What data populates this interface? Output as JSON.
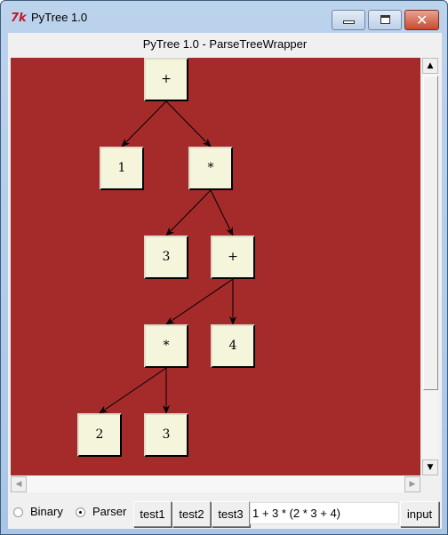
{
  "window": {
    "title": "PyTree 1.0",
    "app_icon": "tk-icon"
  },
  "subtitle": "PyTree 1.0 - ParseTreeWrapper",
  "tree": {
    "nodes": [
      {
        "id": "n0",
        "label": "+"
      },
      {
        "id": "n1",
        "label": "1"
      },
      {
        "id": "n2",
        "label": "*"
      },
      {
        "id": "n3",
        "label": "3"
      },
      {
        "id": "n4",
        "label": "+"
      },
      {
        "id": "n5",
        "label": "*"
      },
      {
        "id": "n6",
        "label": "4"
      },
      {
        "id": "n7",
        "label": "2"
      },
      {
        "id": "n8",
        "label": "3"
      }
    ],
    "edges": [
      [
        "n0",
        "n1"
      ],
      [
        "n0",
        "n2"
      ],
      [
        "n2",
        "n3"
      ],
      [
        "n2",
        "n4"
      ],
      [
        "n4",
        "n5"
      ],
      [
        "n4",
        "n6"
      ],
      [
        "n5",
        "n7"
      ],
      [
        "n5",
        "n8"
      ]
    ]
  },
  "controls": {
    "radio_binary": "Binary",
    "radio_parser": "Parser",
    "selected_mode": "Parser",
    "buttons": [
      "test1",
      "test2",
      "test3"
    ],
    "expression_value": "1 + 3 * (2 * 3 + 4)",
    "input_button": "input"
  }
}
